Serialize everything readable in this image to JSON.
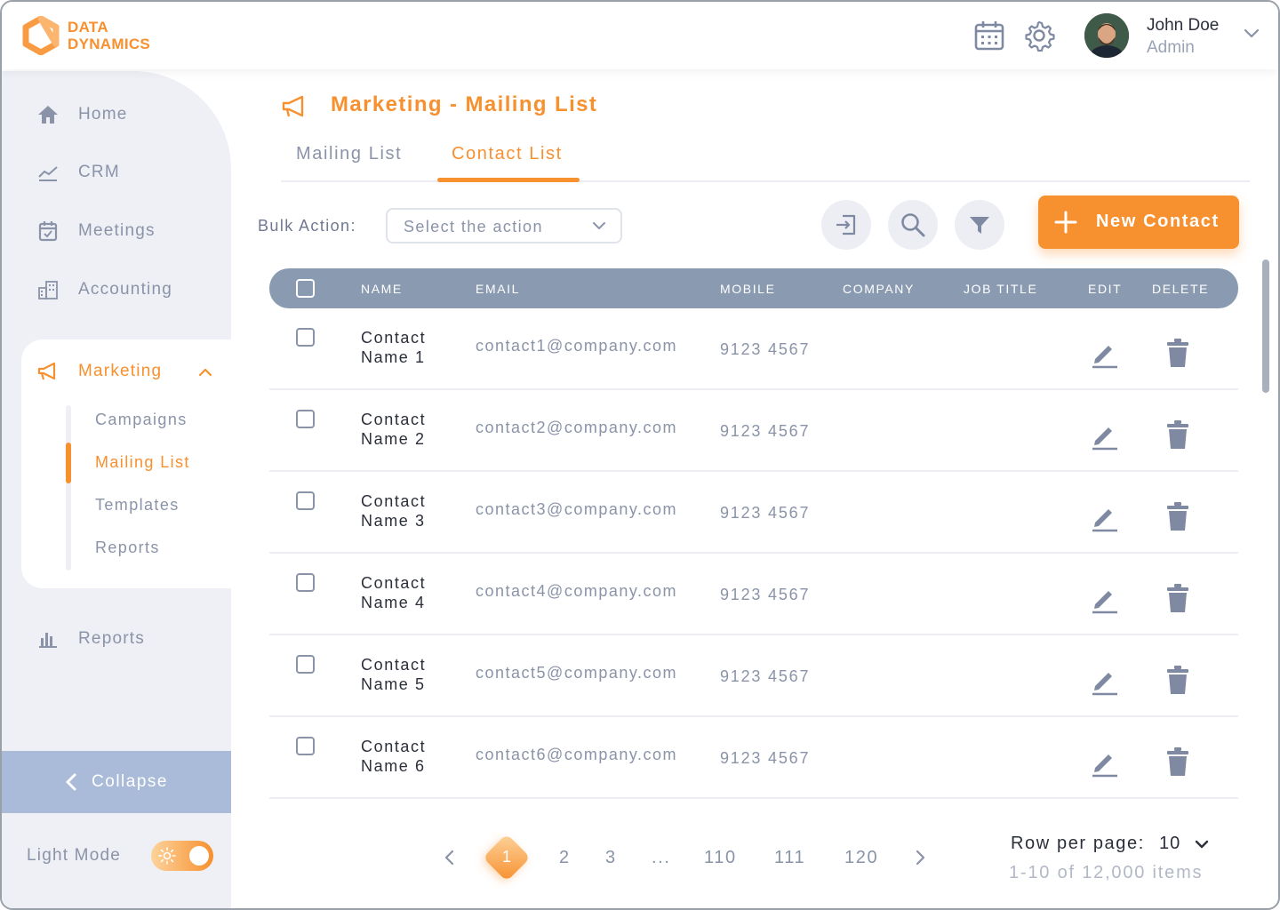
{
  "brand": {
    "line1": "DATA",
    "line2": "DYNAMICS",
    "accent": "#f7902f"
  },
  "header": {
    "calendar_icon": "calendar-icon",
    "settings_icon": "gear-icon",
    "user": {
      "name": "John Doe",
      "role": "Admin"
    }
  },
  "sidebar": {
    "items": [
      {
        "label": "Home",
        "icon": "home-icon"
      },
      {
        "label": "CRM",
        "icon": "trend-line-icon"
      },
      {
        "label": "Meetings",
        "icon": "calendar-check-icon"
      },
      {
        "label": "Accounting",
        "icon": "building-icon"
      },
      {
        "label": "Marketing",
        "icon": "megaphone-icon",
        "expanded": true
      },
      {
        "label": "Reports",
        "icon": "bar-chart-icon"
      }
    ],
    "marketing_sub": [
      "Campaigns",
      "Mailing List",
      "Templates",
      "Reports"
    ],
    "marketing_active": "Mailing List",
    "collapse_label": "Collapse",
    "light_mode_label": "Light Mode",
    "light_mode_on": true
  },
  "page": {
    "title": "Marketing - Mailing List",
    "tabs": [
      {
        "label": "Mailing List",
        "active": false
      },
      {
        "label": "Contact List",
        "active": true
      }
    ]
  },
  "toolbar": {
    "bulk_label": "Bulk Action:",
    "bulk_select_value": "Select the action",
    "import_icon": "import-icon",
    "search_icon": "search-icon",
    "filter_icon": "filter-icon",
    "new_button": "New Contact"
  },
  "table": {
    "columns": [
      "NAME",
      "EMAIL",
      "MOBILE",
      "COMPANY",
      "JOB TITLE",
      "EDIT",
      "DELETE"
    ],
    "rows": [
      {
        "name": "Contact Name 1",
        "email": "contact1@company.com",
        "mobile": "9123 4567",
        "company": "",
        "job_title": ""
      },
      {
        "name": "Contact Name 2",
        "email": "contact2@company.com",
        "mobile": "9123 4567",
        "company": "",
        "job_title": ""
      },
      {
        "name": "Contact Name 3",
        "email": "contact3@company.com",
        "mobile": "9123 4567",
        "company": "",
        "job_title": ""
      },
      {
        "name": "Contact Name 4",
        "email": "contact4@company.com",
        "mobile": "9123 4567",
        "company": "",
        "job_title": ""
      },
      {
        "name": "Contact Name 5",
        "email": "contact5@company.com",
        "mobile": "9123 4567",
        "company": "",
        "job_title": ""
      },
      {
        "name": "Contact Name 6",
        "email": "contact6@company.com",
        "mobile": "9123 4567",
        "company": "",
        "job_title": ""
      }
    ]
  },
  "pagination": {
    "current": "1",
    "pages": [
      "2",
      "3",
      "...",
      "110",
      "111",
      "120"
    ],
    "rows_per_page_label": "Row per page:",
    "rows_per_page": "10",
    "items_summary": "1-10 of 12,000 items"
  }
}
